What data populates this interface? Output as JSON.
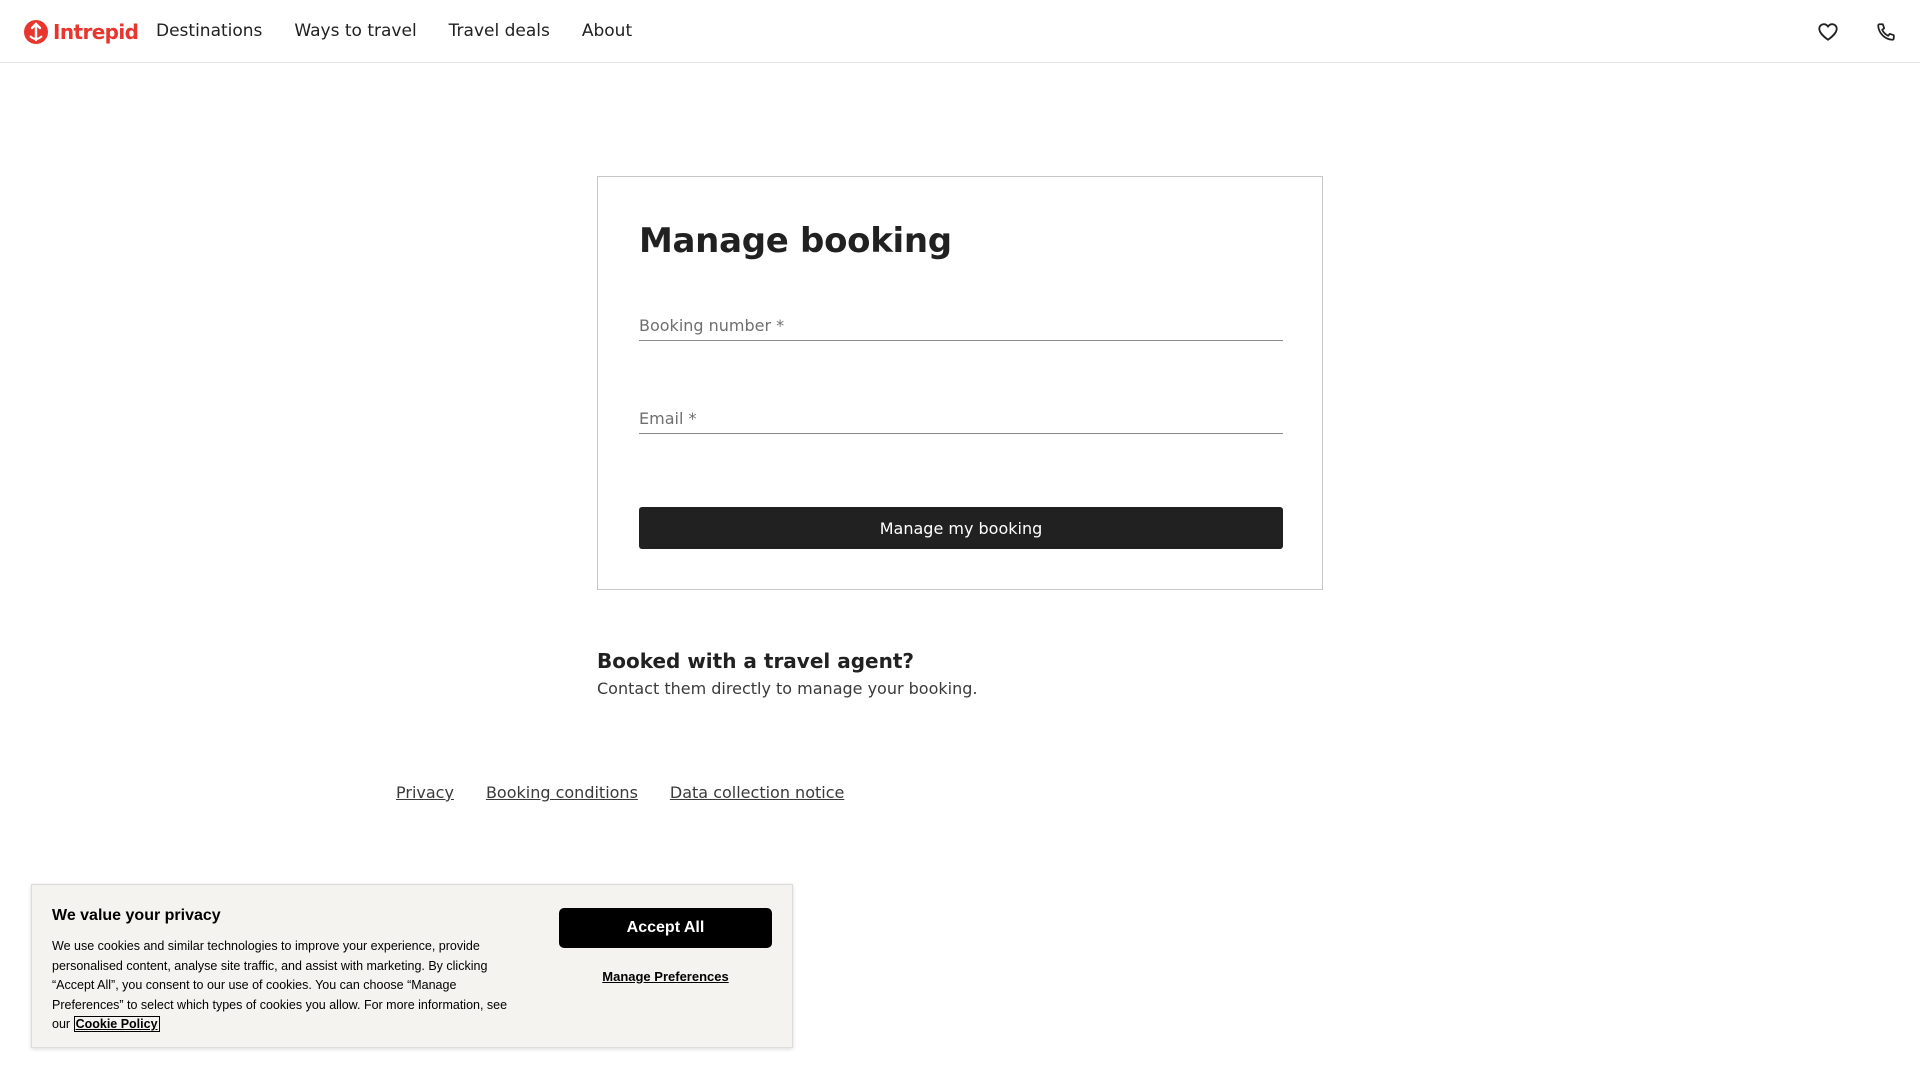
{
  "header": {
    "logo_text": "Intrepid",
    "nav": [
      {
        "label": "Destinations"
      },
      {
        "label": "Ways to travel"
      },
      {
        "label": "Travel deals"
      },
      {
        "label": "About"
      }
    ],
    "icons": [
      "heart-icon",
      "phone-icon"
    ]
  },
  "booking": {
    "title": "Manage booking",
    "booking_number_placeholder": "Booking number *",
    "email_placeholder": "Email *",
    "submit_label": "Manage my booking"
  },
  "agent": {
    "title": "Booked with a travel agent?",
    "text": "Contact them directly to manage your booking."
  },
  "footer": {
    "links": [
      {
        "label": "Privacy"
      },
      {
        "label": "Booking conditions"
      },
      {
        "label": "Data collection notice"
      }
    ]
  },
  "cookie": {
    "title": "We value your privacy",
    "text": "We use cookies and similar technologies to improve your experience, provide personalised content, analyse site traffic, and assist with marketing. By clicking “Accept All”, you consent to our use of cookies. You can choose “Manage Preferences” to select which types of cookies you allow. For more information, see our",
    "policy_link": "Cookie Policy",
    "accept_label": "Accept All",
    "manage_label": "Manage Preferences"
  },
  "colors": {
    "brand": "#e8352e",
    "primary_button": "#212121",
    "cookie_bg": "#f4f3f0"
  }
}
